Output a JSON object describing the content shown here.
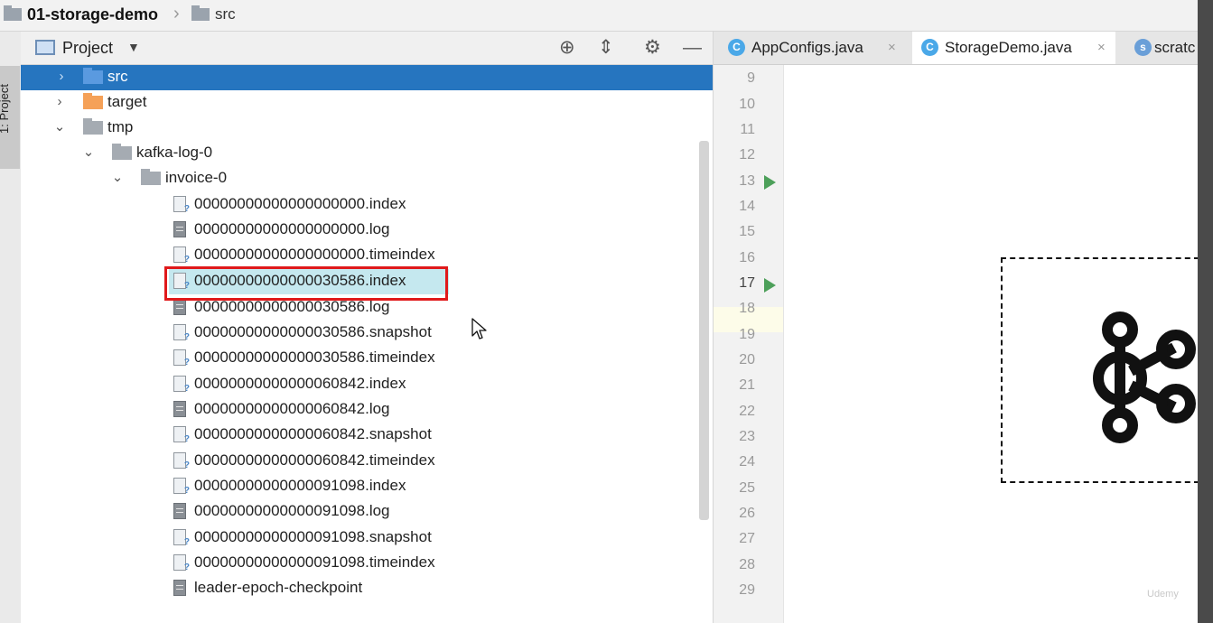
{
  "breadcrumb": {
    "project": "01-storage-demo",
    "separator": "›",
    "folder": "src"
  },
  "left_strip": {
    "label": "1: Project"
  },
  "project_panel": {
    "title": "Project",
    "dropdown_icon": "caret-down-icon",
    "header_icons": [
      "locate-icon",
      "collapse-all-icon",
      "gear-icon",
      "hide-icon"
    ]
  },
  "tree": {
    "src": "src",
    "target": "target",
    "tmp": "tmp",
    "kafka_log": "kafka-log-0",
    "invoice": "invoice-0",
    "files": [
      "00000000000000000000.index",
      "00000000000000000000.log",
      "00000000000000000000.timeindex",
      "00000000000000030586.index",
      "00000000000000030586.log",
      "00000000000000030586.snapshot",
      "00000000000000030586.timeindex",
      "00000000000000060842.index",
      "00000000000000060842.log",
      "00000000000000060842.snapshot",
      "00000000000000060842.timeindex",
      "00000000000000091098.index",
      "00000000000000091098.log",
      "00000000000000091098.snapshot",
      "00000000000000091098.timeindex",
      "leader-epoch-checkpoint"
    ]
  },
  "editor": {
    "tabs": [
      {
        "label": "AppConfigs.java",
        "close": "×"
      },
      {
        "label": "StorageDemo.java",
        "close": "×"
      },
      {
        "label": "scratc"
      }
    ],
    "line_numbers": [
      "9",
      "10",
      "11",
      "12",
      "13",
      "14",
      "15",
      "16",
      "17",
      "18",
      "19",
      "20",
      "21",
      "22",
      "23",
      "24",
      "25",
      "26",
      "27",
      "28",
      "29"
    ]
  },
  "watermark": "Udemy",
  "colors": {
    "selection": "#2675bf",
    "highlight_box": "#e0191b",
    "run_arrow": "#4da05a",
    "file_highlight": "#c5e8ef"
  }
}
